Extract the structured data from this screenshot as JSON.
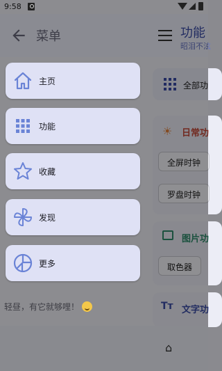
{
  "status_bar": {
    "time": "9:58"
  },
  "drawer": {
    "title": "菜单",
    "items": [
      {
        "label": "主页",
        "icon": "home-icon"
      },
      {
        "label": "功能",
        "icon": "grid-icon"
      },
      {
        "label": "收藏",
        "icon": "star-icon"
      },
      {
        "label": "发现",
        "icon": "pinwheel-icon"
      },
      {
        "label": "更多",
        "icon": "more-icon"
      }
    ],
    "footer": "轻昼，有它就够哩！"
  },
  "main_background": {
    "title": "功能",
    "subtitle": "昭泪不泫",
    "all_functions": "全部功",
    "daily_section": "日常功",
    "daily_chips": [
      "全屏时钟",
      "罗盘时钟"
    ],
    "image_section": "图片功",
    "image_chips": [
      "取色器"
    ],
    "text_section": "文字功",
    "text_icon": "Tт"
  },
  "colors": {
    "accent": "#3b4da8",
    "drawer_item_bg": "#dfe1f5",
    "icon_blue": "#6a83d6"
  }
}
